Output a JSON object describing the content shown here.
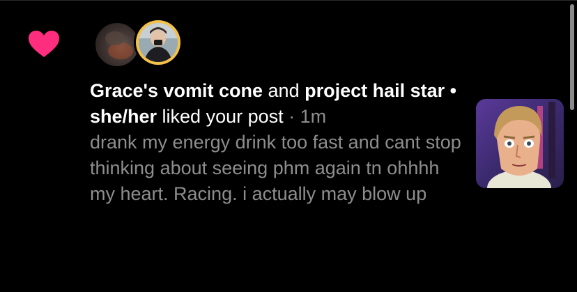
{
  "notification": {
    "type": "like",
    "heart_color": "#ff2d7e",
    "user_one": "Grace's vomit cone",
    "connector": " and ",
    "user_two": "project hail star • she/her",
    "action": " liked your post",
    "separator": " · ",
    "timestamp": "1m",
    "post_text": "drank my energy drink too fast and cant stop thinking about seeing phm again tn ohhhh my heart. Racing. i actually may blow up",
    "thumbnail_alt": "post thumbnail"
  },
  "icons": {
    "heart": "heart-icon"
  },
  "colors": {
    "background": "#000000",
    "primary_text": "#ffffff",
    "secondary_text": "#8e8e8e",
    "avatar_ring": "#f4c24a"
  }
}
